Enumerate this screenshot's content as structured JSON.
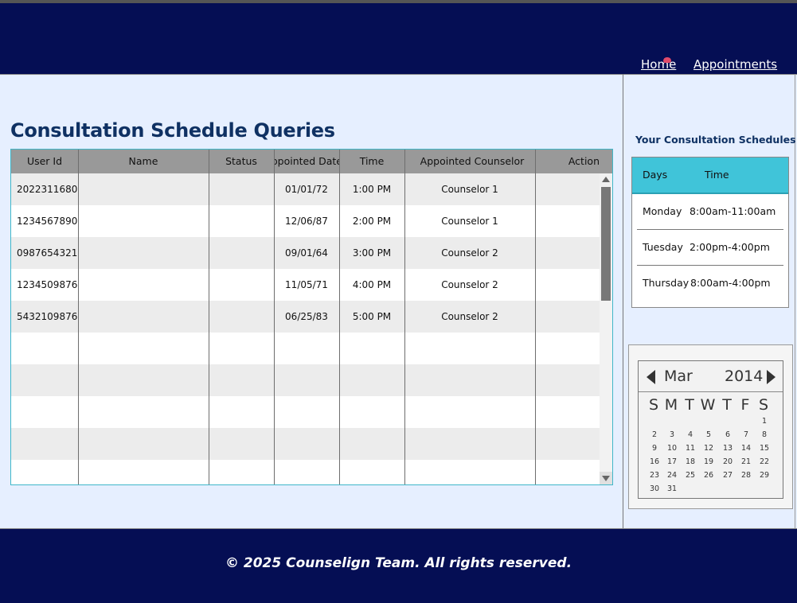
{
  "nav": {
    "home": "Home",
    "appointments": "Appointments"
  },
  "page_title": "Consultation Schedule Queries",
  "table": {
    "columns": [
      "User Id",
      "Name",
      "Status",
      "Appointed Date",
      "Time",
      "Appointed Counselor",
      "Action"
    ],
    "rows": [
      {
        "user_id": "2022311680",
        "name": "",
        "status": "",
        "date": "01/01/72",
        "time": "1:00 PM",
        "counselor": "Counselor 1",
        "action": ""
      },
      {
        "user_id": "1234567890",
        "name": "",
        "status": "",
        "date": "12/06/87",
        "time": "2:00 PM",
        "counselor": "Counselor 1",
        "action": ""
      },
      {
        "user_id": "0987654321",
        "name": "",
        "status": "",
        "date": "09/01/64",
        "time": "3:00 PM",
        "counselor": "Counselor 2",
        "action": ""
      },
      {
        "user_id": "1234509876",
        "name": "",
        "status": "",
        "date": "11/05/71",
        "time": "4:00 PM",
        "counselor": "Counselor 2",
        "action": ""
      },
      {
        "user_id": "5432109876",
        "name": "",
        "status": "",
        "date": "06/25/83",
        "time": "5:00 PM",
        "counselor": "Counselor 2",
        "action": ""
      }
    ]
  },
  "schedules": {
    "title": "Your Consultation Schedules",
    "headers": {
      "days": "Days",
      "time": "Time"
    },
    "rows": [
      {
        "day": "Monday",
        "time": "8:00am-11:00am"
      },
      {
        "day": "Tuesday",
        "time": "2:00pm-4:00pm"
      },
      {
        "day": "Thursday",
        "time": "8:00am-4:00pm"
      }
    ]
  },
  "calendar": {
    "month": "Mar",
    "year": "2014",
    "weekdays": [
      "S",
      "M",
      "T",
      "W",
      "T",
      "F",
      "S"
    ],
    "days": [
      "1",
      "2",
      "3",
      "4",
      "5",
      "6",
      "7",
      "8",
      "9",
      "10",
      "11",
      "12",
      "13",
      "14",
      "15",
      "16",
      "17",
      "18",
      "19",
      "20",
      "21",
      "22",
      "23",
      "24",
      "25",
      "26",
      "27",
      "28",
      "29",
      "30",
      "31"
    ]
  },
  "footer": {
    "copyright": "© 2025 Counselign Team. All rights reserved."
  },
  "colors": {
    "header_bg": "#050e54",
    "page_bg": "#e6efff",
    "title": "#0f3163",
    "accent": "#40c4d9",
    "grid_header": "#999999"
  }
}
